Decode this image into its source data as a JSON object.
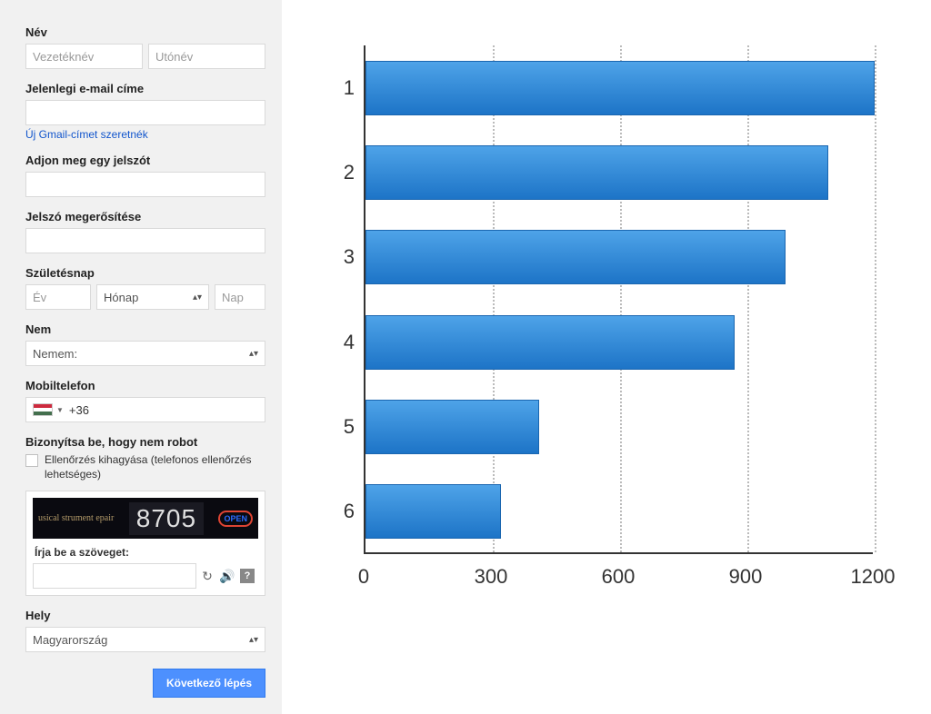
{
  "form": {
    "name_label": "Név",
    "first_name_placeholder": "Vezetéknév",
    "last_name_placeholder": "Utónév",
    "email_label": "Jelenlegi e-mail címe",
    "new_gmail_link": "Új Gmail-címet szeretnék",
    "password_label": "Adjon meg egy jelszót",
    "confirm_label": "Jelszó megerősítése",
    "bday_label": "Születésnap",
    "year_placeholder": "Év",
    "month_placeholder": "Hónap",
    "day_placeholder": "Nap",
    "gender_label": "Nem",
    "gender_placeholder": "Nemem:",
    "mobile_label": "Mobiltelefon",
    "phone_prefix": "+36",
    "prove_label": "Bizonyítsa be, hogy nem robot",
    "skip_check": "Ellenőrzés kihagyása (telefonos ellenőrzés lehetséges)",
    "captcha_number": "8705",
    "captcha_left": "usical\nstrument\nepair",
    "captcha_type_label": "Írja be a szöveget:",
    "location_label": "Hely",
    "location_value": "Magyarország",
    "next_button": "Következő lépés"
  },
  "chart_data": {
    "type": "bar",
    "orientation": "horizontal",
    "categories": [
      "1",
      "2",
      "3",
      "4",
      "5",
      "6"
    ],
    "values": [
      1200,
      1090,
      990,
      870,
      410,
      320
    ],
    "xlabel": "",
    "ylabel": "",
    "xlim": [
      0,
      1200
    ],
    "xticks": [
      0,
      300,
      600,
      900,
      1200
    ],
    "grid": true,
    "bar_color": "#2f86d6"
  }
}
